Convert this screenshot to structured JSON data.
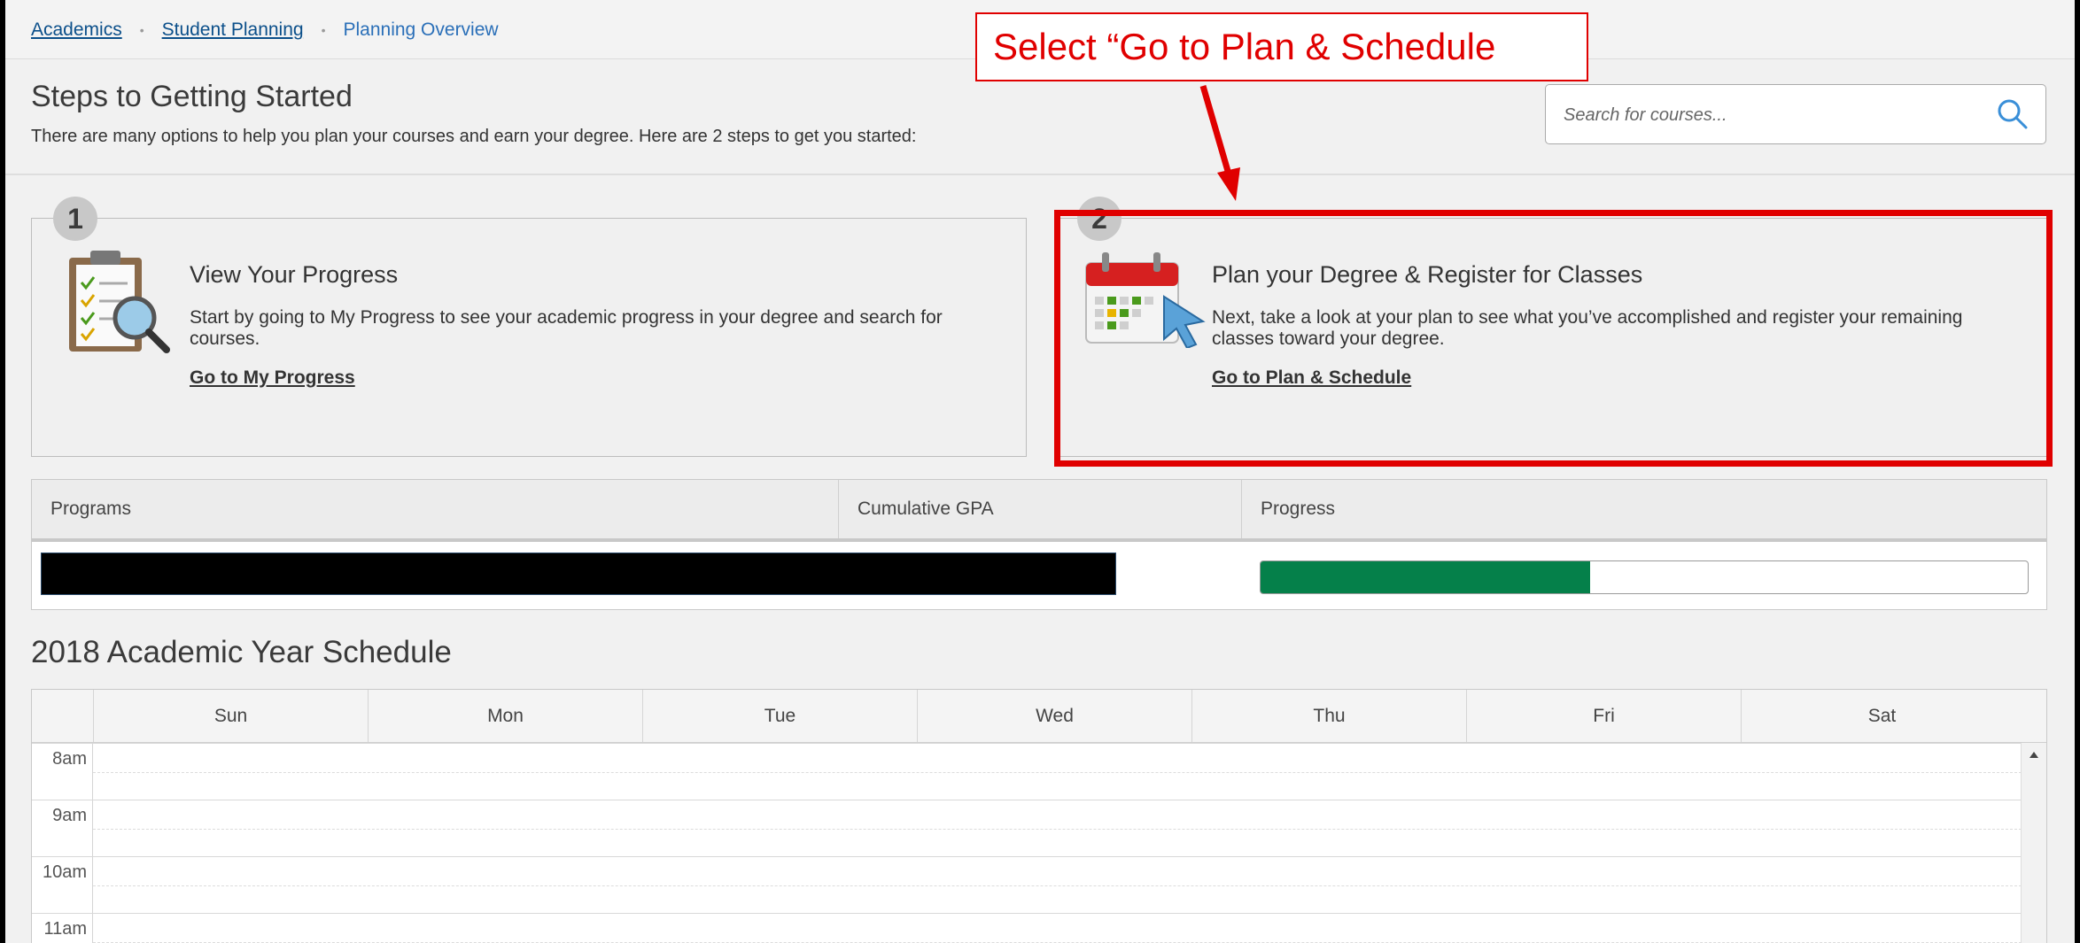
{
  "breadcrumb": {
    "items": [
      "Academics",
      "Student Planning"
    ],
    "current": "Planning Overview"
  },
  "header": {
    "title": "Steps to Getting Started",
    "subtitle": "There are many options to help you plan your courses and earn your degree. Here are 2 steps to get you started:"
  },
  "search": {
    "placeholder": "Search for courses...",
    "icon": "search-icon"
  },
  "steps": [
    {
      "number": "1",
      "icon": "clipboard-magnifier-icon",
      "title": "View Your Progress",
      "description": "Start by going to My Progress to see your academic progress in your degree and search for courses.",
      "link": "Go to My Progress"
    },
    {
      "number": "2",
      "icon": "calendar-cursor-icon",
      "title": "Plan your Degree & Register for Classes",
      "description": "Next, take a look at your plan to see what you’ve accomplished and register your remaining classes toward your degree.",
      "link": "Go to Plan & Schedule"
    }
  ],
  "programs_table": {
    "columns": [
      "Programs",
      "Cumulative GPA",
      "Progress"
    ],
    "progress_fraction": 0.43,
    "progress_color": "#05804a"
  },
  "schedule": {
    "title": "2018 Academic Year Schedule",
    "days": [
      "Sun",
      "Mon",
      "Tue",
      "Wed",
      "Thu",
      "Fri",
      "Sat"
    ],
    "times": [
      "8am",
      "9am",
      "10am",
      "11am"
    ]
  },
  "annotation": {
    "callout_text": "Select “Go to Plan & Schedule",
    "color": "#e00000"
  }
}
